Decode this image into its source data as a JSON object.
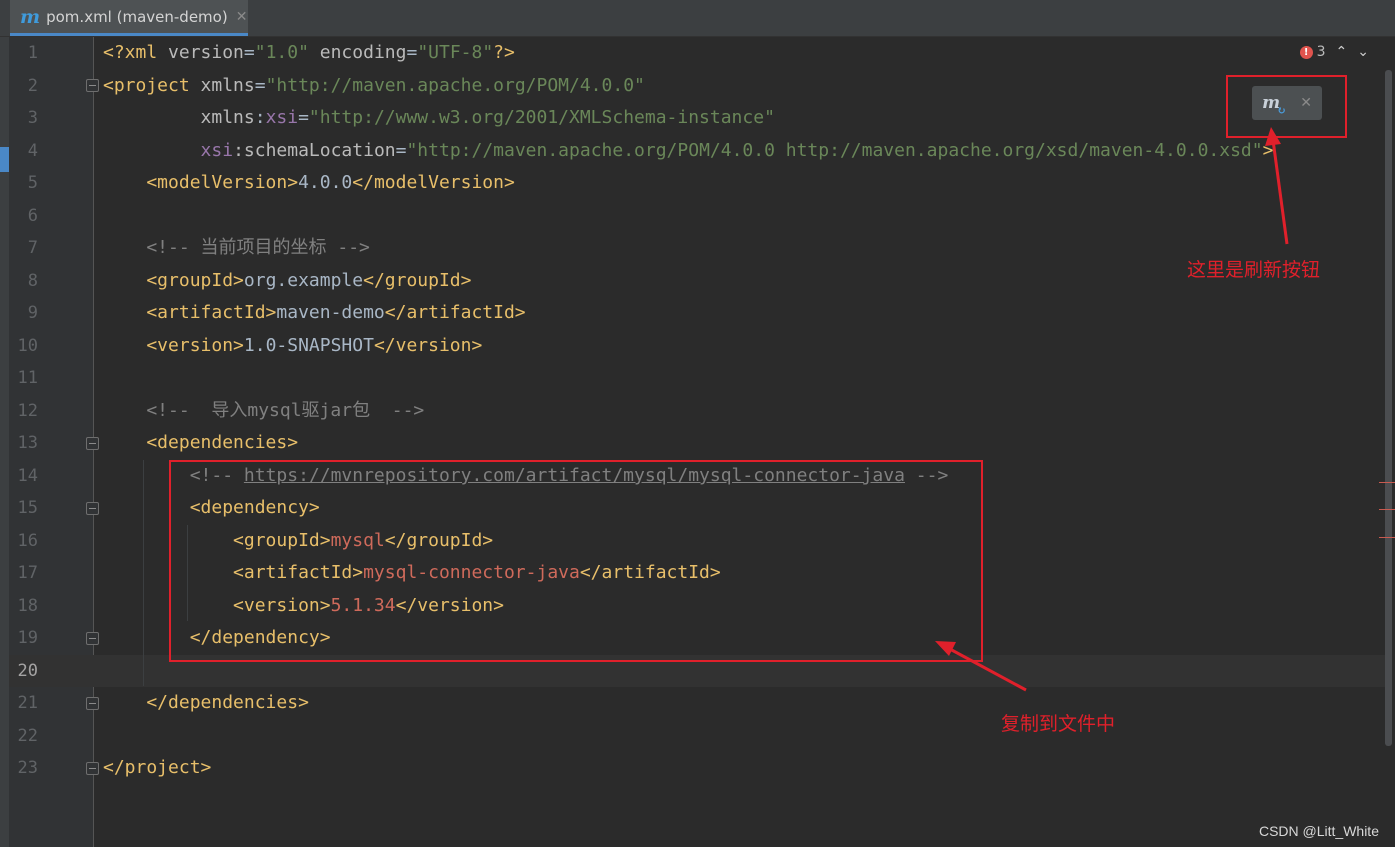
{
  "tab": {
    "icon": "maven-icon",
    "icon_glyph": "m",
    "label": "pom.xml (maven-demo)",
    "close_glyph": "✕"
  },
  "gutter": {
    "line_numbers": [
      "1",
      "2",
      "3",
      "4",
      "5",
      "6",
      "7",
      "8",
      "9",
      "10",
      "11",
      "12",
      "13",
      "14",
      "15",
      "16",
      "17",
      "18",
      "19",
      "20",
      "21",
      "22",
      "23"
    ],
    "current_line": "20"
  },
  "inspections": {
    "error_count": "3",
    "prev_glyph": "⌃",
    "next_glyph": "⌄",
    "icon_glyph": "!"
  },
  "maven_popup": {
    "icon": "maven-reload-icon",
    "icon_glyph": "m",
    "sync_glyph": "↻",
    "close_glyph": "✕"
  },
  "code": {
    "l1": {
      "a": "<?xml ",
      "b": "version",
      "c": "=",
      "d": "\"1.0\"",
      "e": " encoding",
      "f": "=",
      "g": "\"UTF-8\"",
      "h": "?>"
    },
    "l2": {
      "a": "<project ",
      "b": "xmlns",
      "c": "=",
      "d": "\"http://maven.apache.org/POM/4.0.0\""
    },
    "l3": {
      "a": "         xmlns",
      "b": ":",
      "c": "xsi",
      "d": "=",
      "e": "\"http://www.w3.org/2001/XMLSchema-instance\""
    },
    "l4": {
      "a": "         ",
      "b": "xsi",
      "c": ":schemaLocation",
      "d": "=",
      "e": "\"http://maven.apache.org/POM/4.0.0 http://maven.apache.org/xsd/maven-4.0.0.xsd\"",
      "f": ">"
    },
    "l5": {
      "a": "    <modelVersion>",
      "b": "4.0.0",
      "c": "</modelVersion>"
    },
    "l7": {
      "a": "    <!-- 当前项目的坐标 -->"
    },
    "l8": {
      "a": "    <groupId>",
      "b": "org.example",
      "c": "</groupId>"
    },
    "l9": {
      "a": "    <artifactId>",
      "b": "maven-demo",
      "c": "</artifactId>"
    },
    "l10": {
      "a": "    <version>",
      "b": "1.0-SNAPSHOT",
      "c": "</version>"
    },
    "l12": {
      "a": "    <!--  导入mysql驱jar包  -->"
    },
    "l13": {
      "a": "    <dependencies>"
    },
    "l14": {
      "a": "        <!-- ",
      "b": "https://mvnrepository.com/artifact/mysql/mysql-connector-java",
      "c": " -->"
    },
    "l15": {
      "a": "        <dependency>"
    },
    "l16": {
      "a": "            <groupId>",
      "b": "mysql",
      "c": "</groupId>"
    },
    "l17": {
      "a": "            <artifactId>",
      "b": "mysql-connector-java",
      "c": "</artifactId>"
    },
    "l18": {
      "a": "            <version>",
      "b": "5.1.34",
      "c": "</version>"
    },
    "l19": {
      "a": "        </dependency>"
    },
    "l21": {
      "a": "    </dependencies>"
    },
    "l23": {
      "a": "</project>"
    }
  },
  "annotations": {
    "refresh_note": "这里是刷新按钮",
    "copy_note": "复制到文件中"
  },
  "watermark": "CSDN @Litt_White",
  "colors": {
    "annotation": "#e0202b",
    "tag": "#e8bf6a",
    "string": "#6a8759",
    "comment": "#808080",
    "value_red": "#cf6a5b",
    "background": "#2b2b2b"
  }
}
